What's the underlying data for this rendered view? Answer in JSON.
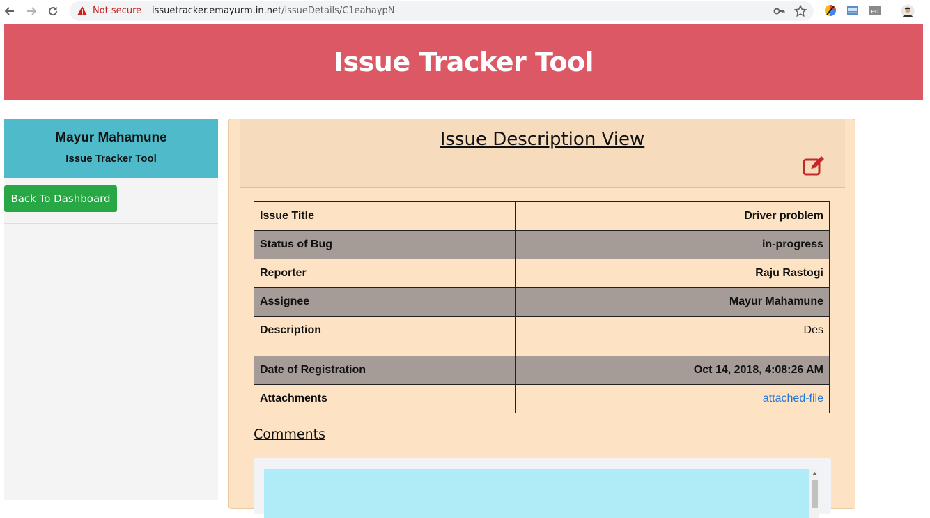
{
  "browser": {
    "security_label": "Not secure",
    "url_host": "issuetracker.emayurm.in.net",
    "url_path": "/issueDetails/C1eahaypN"
  },
  "header": {
    "title": "Issue Tracker Tool"
  },
  "sidebar": {
    "user_name": "Mayur Mahamune",
    "app_name": "Issue Tracker Tool",
    "back_label": "Back To Dashboard"
  },
  "card": {
    "title": "Issue Description View",
    "rows": [
      {
        "label": "Issue Title",
        "value": "Driver problem"
      },
      {
        "label": "Status of Bug",
        "value": "in-progress"
      },
      {
        "label": "Reporter",
        "value": "Raju Rastogi"
      },
      {
        "label": "Assignee",
        "value": "Mayur Mahamune"
      },
      {
        "label": "Description",
        "value": "Des"
      },
      {
        "label": "Date of Registration",
        "value": "Oct 14, 2018, 4:08:26 AM"
      },
      {
        "label": "Attachments",
        "value": "attached-file"
      }
    ],
    "comments_heading": "Comments"
  },
  "colors": {
    "header_bg": "#dc5864",
    "profile_bg": "#4ebaca",
    "back_button_bg": "#28a745",
    "card_bg": "#fde3c3",
    "row_alt_bg": "#a59c98",
    "edit_icon": "#c62828",
    "link": "#2477d6"
  }
}
